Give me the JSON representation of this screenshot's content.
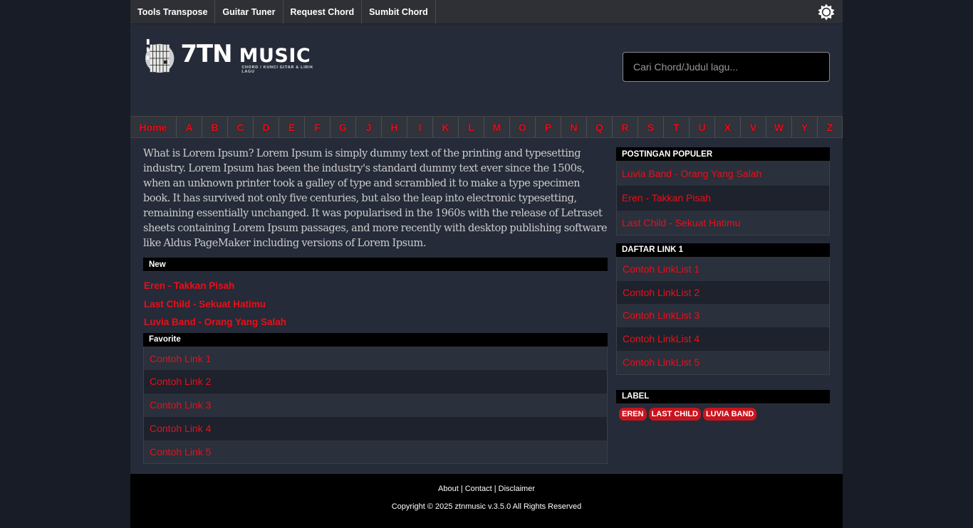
{
  "topnav": {
    "items": [
      "Tools Transpose",
      "Guitar Tuner",
      "Request Chord",
      "Sumbit Chord"
    ],
    "theme_icon": "sun-icon"
  },
  "header": {
    "logo_num": "7TN",
    "logo_word": "MUSIC",
    "logo_sub": "CHORD / KUNCI GITAR & LIRIK LAGU",
    "search_placeholder": "Cari Chord/Judul lagu..."
  },
  "alphabet": [
    "Home",
    "A",
    "B",
    "C",
    "D",
    "E",
    "F",
    "G",
    "J",
    "H",
    "I",
    "K",
    "L",
    "M",
    "O",
    "P",
    "N",
    "Q",
    "R",
    "S",
    "T",
    "U",
    "X",
    "V",
    "W",
    "Y",
    "Z"
  ],
  "main": {
    "intro": "What is Lorem Ipsum? Lorem Ipsum is simply dummy text of the printing and typesetting industry. Lorem Ipsum has been the industry's standard dummy text ever since the 1500s, when an unknown printer took a galley of type and scrambled it to make a type specimen book. It has survived not only five centuries, but also the leap into electronic typesetting, remaining essentially unchanged. It was popularised in the 1960s with the release of Letraset sheets containing Lorem Ipsum passages, and more recently with desktop publishing software like Aldus PageMaker including versions of Lorem Ipsum.",
    "new_title": "New",
    "new_items": [
      "Eren - Takkan Pisah",
      "Last Child - Sekuat Hatimu",
      "Luvia Band - Orang Yang Salah"
    ],
    "fav_title": "Favorite",
    "fav_items": [
      "Contoh Link 1",
      "Contoh Link 2",
      "Contoh Link 3",
      "Contoh Link 4",
      "Contoh Link 5"
    ]
  },
  "sidebar": {
    "popular_title": "POSTINGAN POPULER",
    "popular_items": [
      "Luvia Band - Orang Yang Salah",
      "Eren - Takkan Pisah",
      "Last Child - Sekuat Hatimu"
    ],
    "links_title": "DAFTAR LINK 1",
    "links_items": [
      "Contoh LinkList 1",
      "Contoh LinkList 2",
      "Contoh LinkList 3",
      "Contoh LinkList 4",
      "Contoh LinkList 5"
    ],
    "label_title": "LABEL",
    "labels": [
      "EREN",
      "LAST CHILD",
      "LUVIA BAND"
    ]
  },
  "footer": {
    "about": "About",
    "contact": "Contact",
    "disclaimer": "Disclaimer",
    "sep": "|",
    "copyright": "Copyright © 2025 ztnmusic v.3.5.0 All Rights Reserved"
  },
  "colors": {
    "accent": "#e8101a",
    "bg": "#252b38",
    "page": "#171c26"
  }
}
